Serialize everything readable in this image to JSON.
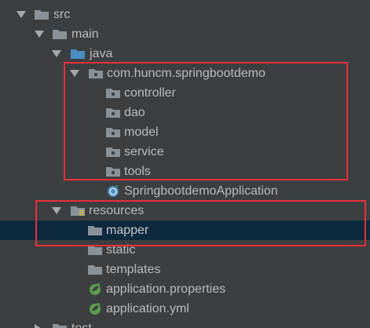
{
  "tree": {
    "rows": [
      {
        "label": "src",
        "kind": "folder",
        "expanded": true,
        "icon": "folder-icon"
      },
      {
        "label": "main",
        "kind": "folder",
        "expanded": true,
        "icon": "folder-icon"
      },
      {
        "label": "java",
        "kind": "source-root",
        "expanded": true,
        "icon": "source-folder-icon"
      },
      {
        "label": "com.huncm.springbootdemo",
        "kind": "package",
        "expanded": true,
        "icon": "package-icon"
      },
      {
        "label": "controller",
        "kind": "package",
        "icon": "package-icon"
      },
      {
        "label": "dao",
        "kind": "package",
        "icon": "package-icon"
      },
      {
        "label": "model",
        "kind": "package",
        "icon": "package-icon"
      },
      {
        "label": "service",
        "kind": "package",
        "icon": "package-icon"
      },
      {
        "label": "tools",
        "kind": "package",
        "icon": "package-icon"
      },
      {
        "label": "SpringbootdemoApplication",
        "kind": "spring-class",
        "icon": "spring-class-icon"
      },
      {
        "label": "resources",
        "kind": "resources-root",
        "expanded": true,
        "icon": "resources-folder-icon"
      },
      {
        "label": "mapper",
        "kind": "folder",
        "selected": true,
        "icon": "folder-icon"
      },
      {
        "label": "static",
        "kind": "folder",
        "icon": "folder-icon"
      },
      {
        "label": "templates",
        "kind": "folder",
        "icon": "folder-icon"
      },
      {
        "label": "application.properties",
        "kind": "spring-config",
        "icon": "spring-config-icon"
      },
      {
        "label": "application.yml",
        "kind": "spring-config",
        "icon": "spring-config-icon"
      },
      {
        "label": "test",
        "kind": "folder",
        "icon": "folder-icon"
      }
    ]
  },
  "colors": {
    "background": "#3c3f41",
    "selection": "#0d293e",
    "text": "#bbbbbb",
    "folder": "#8a9299",
    "source_folder": "#4a8fc5",
    "spring": "#5b9c4e",
    "annotation_box": "#e8303a"
  }
}
